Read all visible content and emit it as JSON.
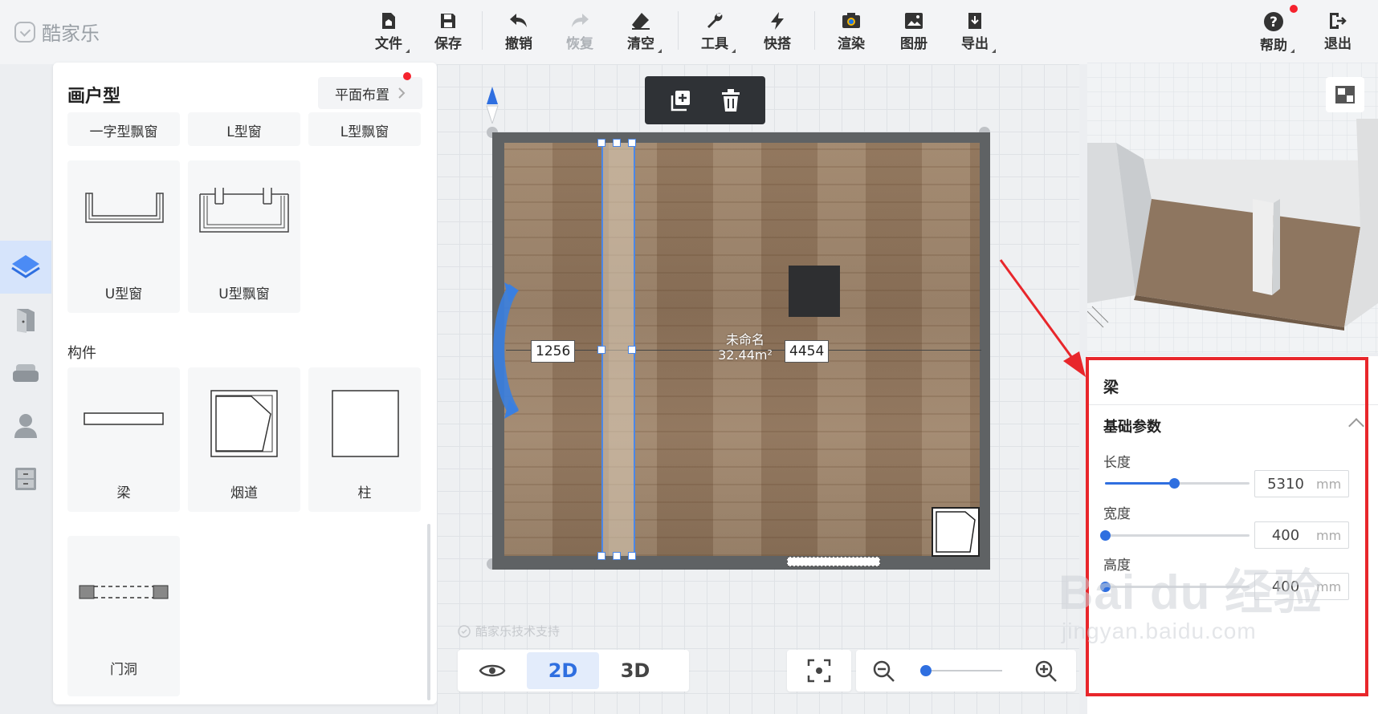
{
  "app": {
    "logo_text": "酷家乐"
  },
  "toolbar": {
    "file": "文件",
    "save": "保存",
    "undo": "撤销",
    "redo": "恢复",
    "clear": "清空",
    "tools": "工具",
    "quick": "快搭",
    "render": "渲染",
    "album": "图册",
    "export": "导出",
    "help": "帮助",
    "exit": "退出"
  },
  "left_panel": {
    "title": "画户型",
    "layout_button": "平面布置",
    "top_row": [
      "一字型飘窗",
      "L型窗",
      "L型飘窗"
    ],
    "windows": [
      "U型窗",
      "U型飘窗"
    ],
    "section_label": "构件",
    "components": [
      "梁",
      "烟道",
      "柱",
      "门洞"
    ]
  },
  "canvas": {
    "room_name": "未命名",
    "room_area": "32.44m²",
    "dim_left": "1256",
    "dim_right": "4454",
    "tech_support": "酷家乐技术支持"
  },
  "view_modes": {
    "mode_2d": "2D",
    "mode_3d": "3D",
    "active": "2D"
  },
  "zoom": {
    "level_fraction": 0.05
  },
  "properties": {
    "title": "梁",
    "group_title": "基础参数",
    "unit": "mm",
    "length": {
      "label": "长度",
      "value": "5310",
      "fraction": 0.48
    },
    "width": {
      "label": "宽度",
      "value": "400",
      "fraction": 0.0
    },
    "height": {
      "label": "高度",
      "value": "400",
      "fraction": 0.0
    }
  },
  "watermark": {
    "brand": "Bai du 经验",
    "url": "jingyan.baidu.com"
  },
  "colors": {
    "accent": "#2f6fe0",
    "highlight_box": "#e8262b",
    "notification": "#f5222d"
  }
}
